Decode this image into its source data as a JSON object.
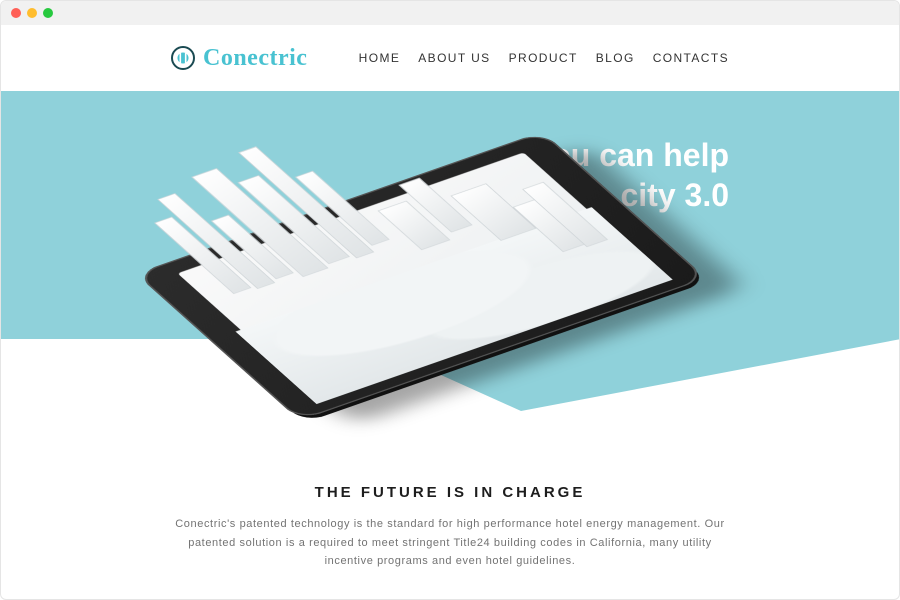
{
  "brand": {
    "name": "Conectric"
  },
  "nav": {
    "home": "HOME",
    "about": "ABOUT US",
    "product": "PRODUCT",
    "blog": "BLOG",
    "contacts": "CONTACTS"
  },
  "hero": {
    "line1": "You can help",
    "line2": "build a city 3.0"
  },
  "sub": {
    "title": "THE FUTURE IS IN CHARGE",
    "body": "Conectric's patented technology is the standard for high performance hotel energy management. Our patented solution is a required to meet stringent Title24 building codes in California, many utility incentive programs and even hotel guidelines."
  },
  "colors": {
    "hero_bg": "#8fd1da",
    "accent": "#49c2d1"
  }
}
